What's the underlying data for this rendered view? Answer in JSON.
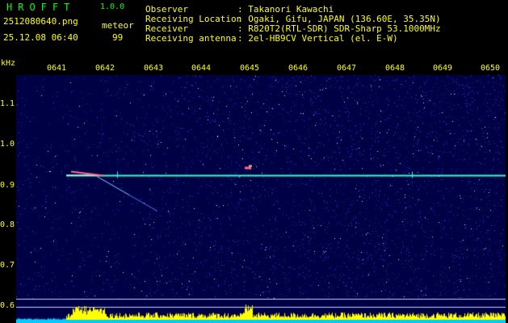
{
  "app": {
    "title": "HROFFT",
    "version": "1.0.0"
  },
  "info": {
    "file_name": "2512080640.png",
    "date_time": "25.12.08 06:40",
    "meteor_label": "meteor",
    "meteor_count": "99"
  },
  "metadata": [
    {
      "label": "Observer",
      "value": ": Takanori Kawachi"
    },
    {
      "label": "Receiving Location",
      "value": ": Ogaki, Gifu, JAPAN (136.60E, 35.35N)"
    },
    {
      "label": "Receiver",
      "value": ": R820T2(RTL-SDR) SDR-Sharp 53.1000MHz"
    },
    {
      "label": "Receiving antenna",
      "value": ": 2el-HB9CV Vertical (el. E-W)"
    }
  ],
  "chart_data": {
    "type": "heatmap",
    "ylabel": "kHz",
    "y_ticks": [
      "1.1",
      "1.0",
      "0.9",
      "0.8",
      "0.7",
      "0.6"
    ],
    "y_tick_values": [
      1.1,
      1.0,
      0.9,
      0.8,
      0.7,
      0.6
    ],
    "x_ticks": [
      "0641",
      "0642",
      "0643",
      "0644",
      "0645",
      "0646",
      "0647",
      "0648",
      "0649",
      "0650"
    ],
    "ylim": [
      0.58,
      1.17
    ],
    "carrier_khz": 0.925,
    "colors": {
      "background": "#000044",
      "noise": "#2a4cff",
      "carrier": "#33ffcc",
      "echo": "#ff6a8a",
      "bars": "#ffff00",
      "base": "#00ccff",
      "axis_text": "#ffff00",
      "title": "#00ff00"
    }
  }
}
